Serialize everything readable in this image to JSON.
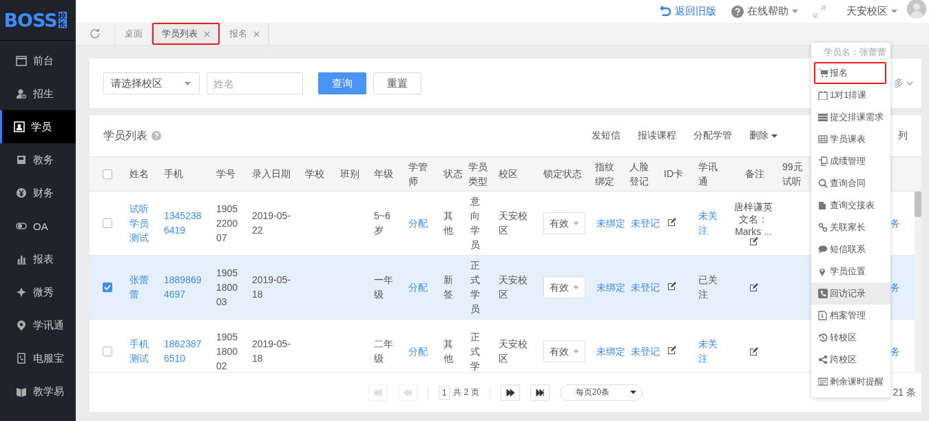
{
  "logo": {
    "text": "BOSS",
    "badge": "校长"
  },
  "sidebar": {
    "items": [
      {
        "label": "前台",
        "selected": false
      },
      {
        "label": "招生",
        "selected": false
      },
      {
        "label": "学员",
        "selected": true
      },
      {
        "label": "教务",
        "selected": false
      },
      {
        "label": "财务",
        "selected": false
      },
      {
        "label": "OA",
        "selected": false
      },
      {
        "label": "报表",
        "selected": false
      },
      {
        "label": "微秀",
        "selected": false
      },
      {
        "label": "学讯通",
        "selected": false
      },
      {
        "label": "电服宝",
        "selected": false
      },
      {
        "label": "教学易",
        "selected": false
      }
    ]
  },
  "header": {
    "back_link": "返回旧版",
    "help": "在线帮助",
    "campus": "天安校区"
  },
  "tabs": [
    {
      "label": "桌面",
      "closable": false,
      "selected": false,
      "highlighted": false
    },
    {
      "label": "学员列表",
      "closable": true,
      "selected": true,
      "highlighted": true
    },
    {
      "label": "报名",
      "closable": true,
      "selected": false,
      "highlighted": false
    }
  ],
  "filter": {
    "campus_select": "请选择校区",
    "name_placeholder": "姓名",
    "search_button": "查询",
    "reset_button": "重置",
    "more": "多"
  },
  "table": {
    "title": "学员列表",
    "actions": [
      "发短信",
      "报读课程",
      "分配学管",
      "删除"
    ],
    "actions_right": "列",
    "all_selected": false,
    "columns": [
      "姓名",
      "手机",
      "学号",
      "录入日期",
      "学校",
      "班别",
      "年级",
      "学管师",
      "状态",
      "学员类型",
      "校区",
      "锁定状态",
      "指纹绑定",
      "人脸登记",
      "ID卡",
      "学讯通",
      "备注",
      "99元试听"
    ],
    "rows": [
      {
        "selected": false,
        "name": "试听学员测试",
        "phone": "13452386419",
        "student_no": "1905220007",
        "entry_date": "2019-05-22",
        "grade": "5~6岁",
        "manager": "分配",
        "status": "其他",
        "type": "意向学员",
        "campus": "天安校区",
        "lock": "有效",
        "fingerprint": "未绑定",
        "face": "未登记",
        "wechat": {
          "text": "未关注",
          "followed": false
        },
        "remark": "唐梓谦英文名：Marks ...",
        "last": "务"
      },
      {
        "selected": true,
        "name": "张蕾蕾",
        "phone": "18898694697",
        "student_no": "1905180003",
        "entry_date": "2019-05-18",
        "grade": "一年级",
        "manager": "分配",
        "status": "新签",
        "type": "正式学员",
        "campus": "天安校区",
        "lock": "有效",
        "fingerprint": "未绑定",
        "face": "未登记",
        "wechat": {
          "text": "已关注",
          "followed": true
        },
        "last": "务"
      },
      {
        "selected": false,
        "name": "手机测试",
        "phone": "18623876510",
        "student_no": "1905180002",
        "entry_date": "2019-05-18",
        "grade": "二年级",
        "manager": "分配",
        "status": "其他",
        "type": "正式学",
        "campus": "天安校区",
        "lock": "有效",
        "fingerprint": "未绑定",
        "face": "未登记",
        "wechat": {
          "text": "未关注",
          "followed": false
        },
        "last": "务"
      }
    ]
  },
  "pager": {
    "buttons": [
      {
        "kind": "first",
        "disabled": true
      },
      {
        "kind": "prev",
        "disabled": true
      },
      {
        "kind": "next",
        "disabled": false
      },
      {
        "kind": "last",
        "disabled": false
      }
    ],
    "page": "1",
    "total_pages": "共 2 页",
    "page_size": "每页20条",
    "total": "21 条"
  },
  "menu": {
    "title": "学员名：张蕾蕾",
    "items": [
      {
        "label": "报名",
        "highlighted": true,
        "hovered": false
      },
      {
        "label": "1对1排课",
        "highlighted": false,
        "hovered": false
      },
      {
        "label": "提交排课需求",
        "highlighted": false,
        "hovered": false
      },
      {
        "label": "学员课表",
        "highlighted": false,
        "hovered": false
      },
      {
        "label": "成绩管理",
        "highlighted": false,
        "hovered": false
      },
      {
        "label": "查询合同",
        "highlighted": false,
        "hovered": false
      },
      {
        "label": "查询交接表",
        "highlighted": false,
        "hovered": false
      },
      {
        "label": "关联家长",
        "highlighted": false,
        "hovered": false
      },
      {
        "label": "短信联系",
        "highlighted": false,
        "hovered": false
      },
      {
        "label": "学员位置",
        "highlighted": false,
        "hovered": false
      },
      {
        "label": "回访记录",
        "highlighted": false,
        "hovered": true
      },
      {
        "label": "档案管理",
        "highlighted": false,
        "hovered": false
      },
      {
        "label": "转校区",
        "highlighted": false,
        "hovered": false
      },
      {
        "label": "跨校区",
        "highlighted": false,
        "hovered": false
      },
      {
        "label": "剩余课时提醒",
        "highlighted": false,
        "hovered": false
      }
    ]
  }
}
